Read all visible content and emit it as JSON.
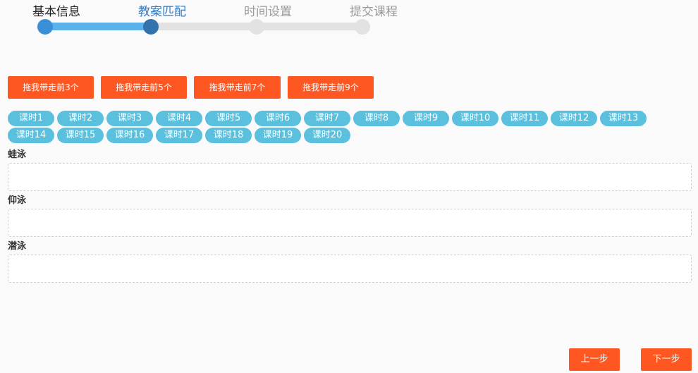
{
  "stepper": {
    "steps": [
      {
        "label": "基本信息",
        "state": "done"
      },
      {
        "label": "教案匹配",
        "state": "active"
      },
      {
        "label": "时间设置",
        "state": "todo"
      },
      {
        "label": "提交课程",
        "state": "todo"
      }
    ],
    "colors": {
      "done": "#3b8fd6",
      "active": "#3372ad",
      "track": "#5bb1ea",
      "todo": "#e2e2e2"
    }
  },
  "quick_buttons": [
    "拖我带走前3个",
    "拖我带走前5个",
    "拖我带走前7个",
    "拖我带走前9个"
  ],
  "lessons": [
    "课时1",
    "课时2",
    "课时3",
    "课时4",
    "课时5",
    "课时6",
    "课时7",
    "课时8",
    "课时9",
    "课时10",
    "课时11",
    "课时12",
    "课时13",
    "课时14",
    "课时15",
    "课时16",
    "课时17",
    "课时18",
    "课时19",
    "课时20"
  ],
  "sections": [
    {
      "title": "蛙泳"
    },
    {
      "title": "仰泳"
    },
    {
      "title": "潜泳"
    }
  ],
  "footer": {
    "prev_label": "上一步",
    "next_label": "下一步"
  },
  "theme": {
    "accent": "#ff5722",
    "pill": "#5bc0de"
  }
}
